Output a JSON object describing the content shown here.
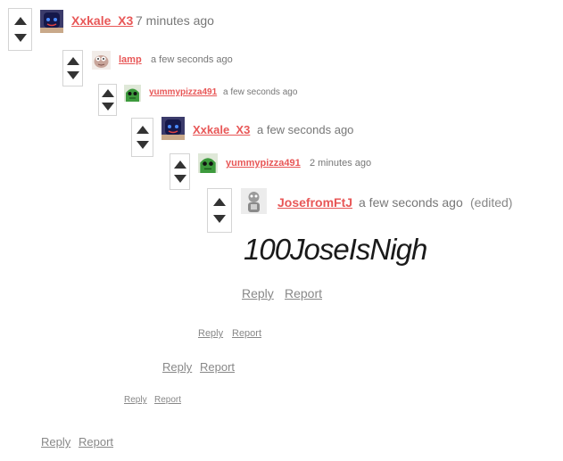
{
  "comments": [
    {
      "username": "Xxkale_X3",
      "time": "7 minutes ago",
      "reply_label": "Reply",
      "report_label": "Report",
      "avatar_icon": "dark-face-avatar-icon"
    },
    {
      "username": "lamp",
      "time": "a few seconds ago",
      "reply_label": "Reply",
      "report_label": "Report",
      "avatar_icon": "pink-creature-avatar-icon"
    },
    {
      "username": "yummypizza491",
      "time": "a few seconds ago",
      "reply_label": "Reply",
      "report_label": "Report",
      "avatar_icon": "green-creature-avatar-icon"
    },
    {
      "username": "Xxkale_X3",
      "time": "a few seconds ago",
      "reply_label": "Reply",
      "report_label": "Report",
      "avatar_icon": "dark-face-avatar-icon"
    },
    {
      "username": "yummypizza491",
      "time": "2 minutes ago",
      "reply_label": "Reply",
      "report_label": "Report",
      "avatar_icon": "green-creature-avatar-icon"
    },
    {
      "username": "JosefromFtJ",
      "time": "a few seconds ago",
      "edited": "(edited)",
      "body": "100JoseIsNigh",
      "reply_label": "Reply",
      "report_label": "Report",
      "avatar_icon": "grey-figure-avatar-icon"
    }
  ],
  "colors": {
    "username": "#e85757",
    "meta": "#777777",
    "body": "#1a1a1a",
    "border": "#d4d4d4"
  }
}
